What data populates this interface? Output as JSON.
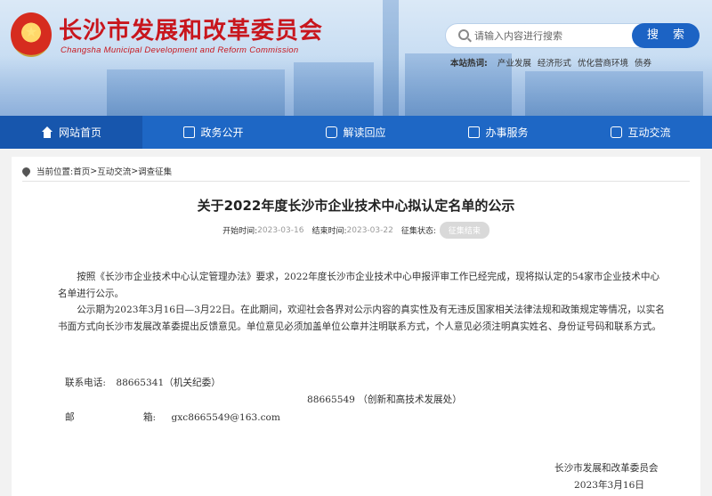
{
  "header": {
    "site_title": "长沙市发展和改革委员会",
    "site_subtitle": "Changsha Municipal Development and Reform Commission",
    "emblem": "national-emblem",
    "search": {
      "placeholder": "请输入内容进行搜索",
      "button_label": "搜 索"
    },
    "hotwords": {
      "label": "本站热词:",
      "items": [
        "产业发展",
        "经济形式",
        "优化营商环境",
        "债券"
      ]
    }
  },
  "nav": {
    "items": [
      {
        "label": "网站首页",
        "icon": "home-icon",
        "active": true
      },
      {
        "label": "政务公开",
        "icon": "document-icon",
        "active": false
      },
      {
        "label": "解读回应",
        "icon": "chat-icon",
        "active": false
      },
      {
        "label": "办事服务",
        "icon": "play-screen-icon",
        "active": false
      },
      {
        "label": "互动交流",
        "icon": "message-icon",
        "active": false
      }
    ]
  },
  "breadcrumb": {
    "prefix": "当前位置:",
    "items": [
      "首页",
      "互动交流",
      "调查征集"
    ],
    "separator": ">"
  },
  "article": {
    "title": "关于2022年度长沙市企业技术中心拟认定名单的公示",
    "start_label": "开始时间:",
    "start_value": "2023-03-16",
    "end_label": "结束时间:",
    "end_value": "2023-03-22",
    "status_label": "征集状态:",
    "status_value": "征集结束",
    "paragraphs": [
      "按照《长沙市企业技术中心认定管理办法》要求，2022年度长沙市企业技术中心申报评审工作已经完成，现将拟认定的54家市企业技术中心名单进行公示。",
      "公示期为2023年3月16日—3月22日。在此期间，欢迎社会各界对公示内容的真实性及有无违反国家相关法律法规和政策规定等情况，以实名书面方式向长沙市发展改革委提出反馈意见。单位意见必须加盖单位公章并注明联系方式，个人意见必须注明真实姓名、身份证号码和联系方式。"
    ],
    "contact_phone_label": "联系电话:",
    "contact_phone_1": "88665341（机关纪委）",
    "contact_phone_2": "88665549 （创新和高技术发展处）",
    "email_label_1": "邮",
    "email_label_2": "箱:",
    "email_value": "gxc8665549@163.com",
    "signature_org": "长沙市发展和改革委员会",
    "signature_date": "2023年3月16日"
  },
  "colors": {
    "brand_red": "#c8161d",
    "nav_blue": "#1e67c5",
    "nav_active": "#1756ad"
  }
}
